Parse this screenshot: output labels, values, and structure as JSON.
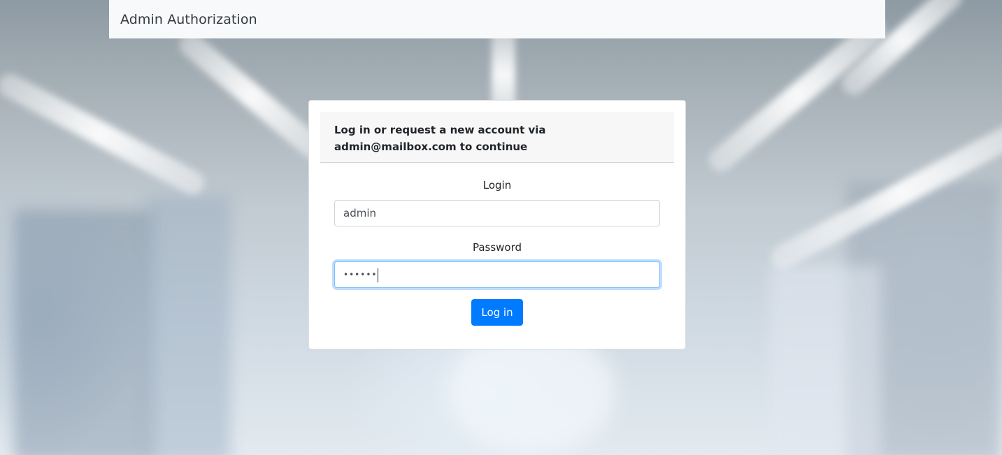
{
  "navbar": {
    "brand": "Admin Authorization"
  },
  "login_card": {
    "header": "Log in or request a new account via admin@mailbox.com to continue",
    "login_label": "Login",
    "login_value": "admin",
    "password_label": "Password",
    "password_value": "••••••",
    "submit_label": "Log in"
  },
  "colors": {
    "primary": "#007bff",
    "navbar_bg": "#f8f9fa",
    "focus_border": "#80bdff"
  }
}
